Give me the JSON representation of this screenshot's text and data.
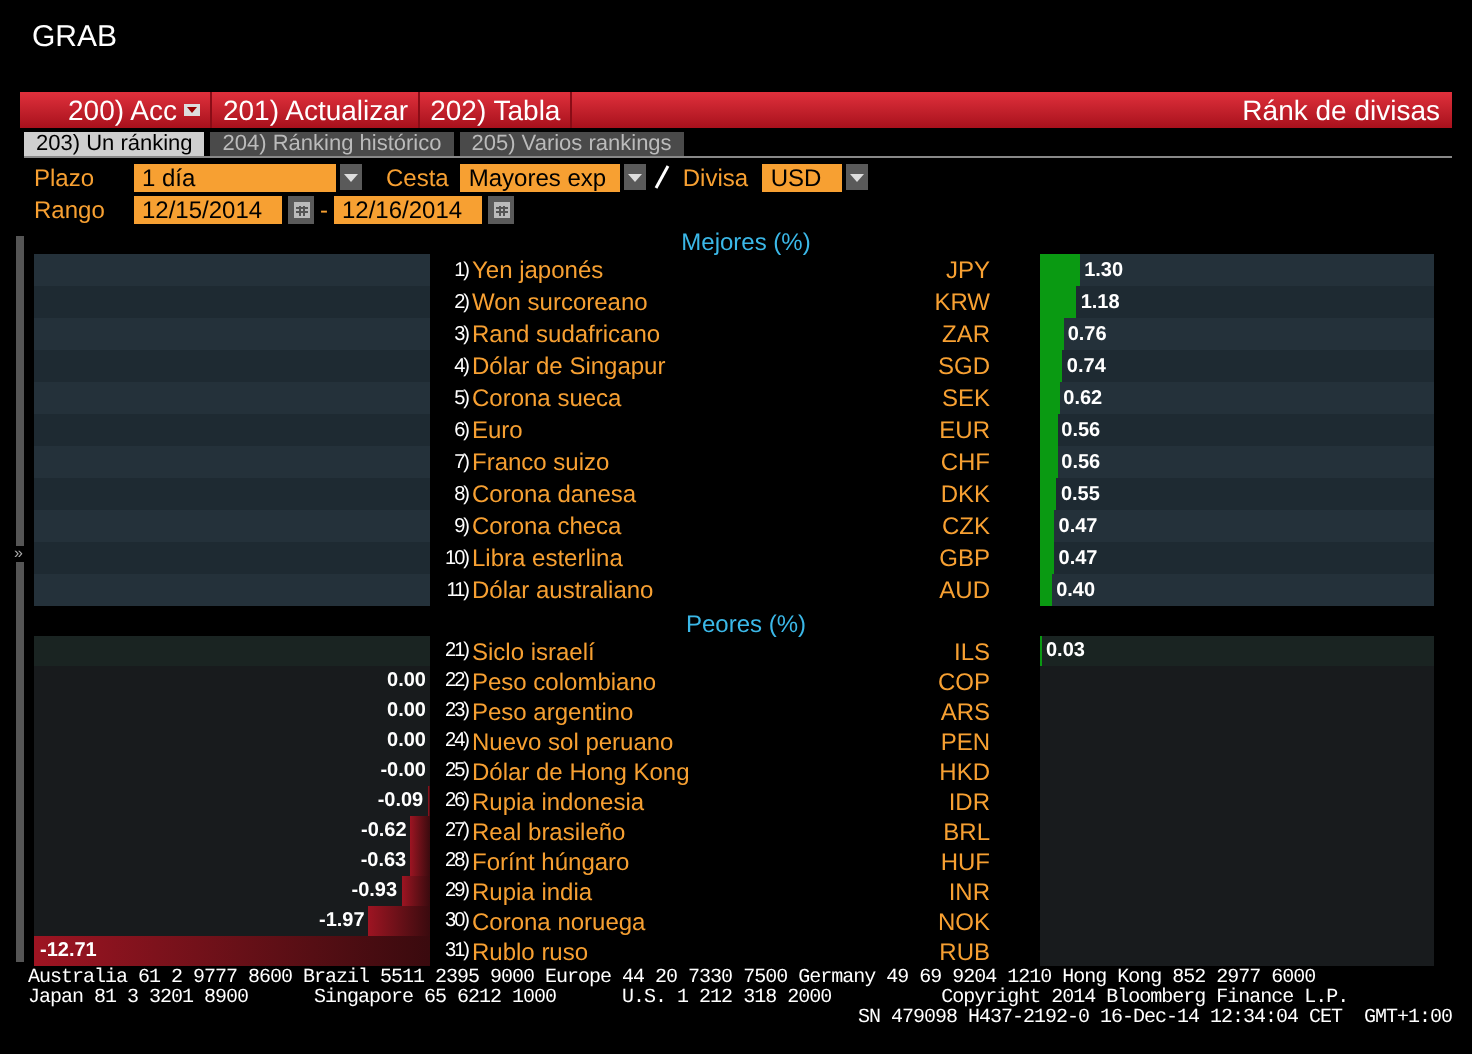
{
  "window": {
    "title": "GRAB"
  },
  "menu": {
    "buttons": [
      {
        "label": "200) Acc",
        "dropdown": true
      },
      {
        "label": "201) Actualizar",
        "dropdown": false
      },
      {
        "label": "202) Tabla",
        "dropdown": false
      }
    ],
    "title": "Ránk de divisas"
  },
  "tabs": [
    {
      "label": "203) Un ránking",
      "selected": true
    },
    {
      "label": "204) Ránking histórico",
      "selected": false
    },
    {
      "label": "205) Varios rankings",
      "selected": false
    }
  ],
  "form": {
    "plazo": {
      "label": "Plazo",
      "value": "1 día"
    },
    "cesta": {
      "label": "Cesta",
      "value": "Mayores exp"
    },
    "divisa": {
      "label": "Divisa",
      "value": "USD"
    },
    "rango": {
      "label": "Rango",
      "from": "12/15/2014",
      "separator": "-",
      "to": "12/16/2014"
    }
  },
  "panel_toggle": "»",
  "best": {
    "heading": "Mejores (%)",
    "rows": [
      {
        "rank": "1)",
        "name": "Yen japonés",
        "code": "JPY",
        "value": "1.30",
        "level": 0.102,
        "kind": "gain"
      },
      {
        "rank": "2)",
        "name": "Won surcoreano",
        "code": "KRW",
        "value": "1.18",
        "level": 0.093,
        "kind": "gain"
      },
      {
        "rank": "3)",
        "name": "Rand sudafricano",
        "code": "ZAR",
        "value": "0.76",
        "level": 0.06,
        "kind": "gain"
      },
      {
        "rank": "4)",
        "name": "Dólar de Singapur",
        "code": "SGD",
        "value": "0.74",
        "level": 0.058,
        "kind": "gain"
      },
      {
        "rank": "5)",
        "name": "Corona sueca",
        "code": "SEK",
        "value": "0.62",
        "level": 0.049,
        "kind": "gain"
      },
      {
        "rank": "6)",
        "name": "Euro",
        "code": "EUR",
        "value": "0.56",
        "level": 0.044,
        "kind": "gain"
      },
      {
        "rank": "7)",
        "name": "Franco suizo",
        "code": "CHF",
        "value": "0.56",
        "level": 0.044,
        "kind": "gain"
      },
      {
        "rank": "8)",
        "name": "Corona danesa",
        "code": "DKK",
        "value": "0.55",
        "level": 0.043,
        "kind": "gain"
      },
      {
        "rank": "9)",
        "name": "Corona checa",
        "code": "CZK",
        "value": "0.47",
        "level": 0.037,
        "kind": "gain"
      },
      {
        "rank": "10)",
        "name": "Libra esterlina",
        "code": "GBP",
        "value": "0.47",
        "level": 0.037,
        "kind": "gain"
      },
      {
        "rank": "11)",
        "name": "Dólar australiano",
        "code": "AUD",
        "value": "0.40",
        "level": 0.031,
        "kind": "gain"
      }
    ]
  },
  "worst": {
    "heading": "Peores (%)",
    "rows": [
      {
        "rank": "21)",
        "name": "Siclo israelí",
        "code": "ILS",
        "value": "0.03",
        "level": 0.002,
        "kind": "gain"
      },
      {
        "rank": "22)",
        "name": "Peso colombiano",
        "code": "COP",
        "value": "0.00",
        "level": 0,
        "kind": "loss"
      },
      {
        "rank": "23)",
        "name": "Peso argentino",
        "code": "ARS",
        "value": "0.00",
        "level": 0,
        "kind": "loss"
      },
      {
        "rank": "24)",
        "name": "Nuevo sol peruano",
        "code": "PEN",
        "value": "0.00",
        "level": 0,
        "kind": "loss"
      },
      {
        "rank": "25)",
        "name": "Dólar de Hong Kong",
        "code": "HKD",
        "value": "-0.00",
        "level": 0,
        "kind": "loss"
      },
      {
        "rank": "26)",
        "name": "Rupia indonesia",
        "code": "IDR",
        "value": "-0.09",
        "level": 0.007,
        "kind": "loss"
      },
      {
        "rank": "27)",
        "name": "Real brasileño",
        "code": "BRL",
        "value": "-0.62",
        "level": 0.049,
        "kind": "loss"
      },
      {
        "rank": "28)",
        "name": "Forínt húngaro",
        "code": "HUF",
        "value": "-0.63",
        "level": 0.05,
        "kind": "loss"
      },
      {
        "rank": "29)",
        "name": "Rupia india",
        "code": "INR",
        "value": "-0.93",
        "level": 0.073,
        "kind": "loss"
      },
      {
        "rank": "30)",
        "name": "Corona noruega",
        "code": "NOK",
        "value": "-1.97",
        "level": 0.155,
        "kind": "loss"
      },
      {
        "rank": "31)",
        "name": "Rublo ruso",
        "code": "RUB",
        "value": "-12.71",
        "level": 1,
        "kind": "loss"
      }
    ]
  },
  "footer": [
    "Australia 61 2 9777 8600 Brazil 5511 2395 9000 Europe 44 20 7330 7500 Germany 49 69 9204 1210 Hong Kong 852 2977 6000",
    "Japan 81 3 3201 8900      Singapore 65 6212 1000      U.S. 1 212 318 2000          Copyright 2014 Bloomberg Finance L.P.",
    "SN 479098 H437-2192-0 16-Dec-14 12:34:04 CET  GMT+1:00"
  ]
}
